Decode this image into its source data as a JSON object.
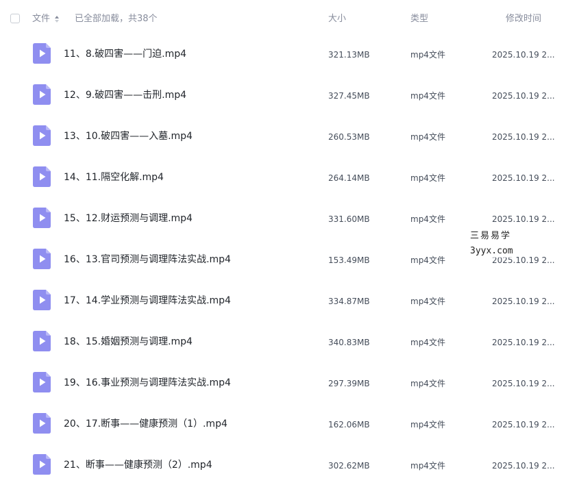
{
  "header": {
    "name_label": "文件",
    "loaded_label": "已全部加载，共38个",
    "size_label": "大小",
    "type_label": "类型",
    "time_label": "修改时间"
  },
  "files": [
    {
      "name": "11、8.破四害——门迫.mp4",
      "size": "321.13MB",
      "type": "mp4文件",
      "time": "2025.10.19 2..."
    },
    {
      "name": "12、9.破四害——击刑.mp4",
      "size": "327.45MB",
      "type": "mp4文件",
      "time": "2025.10.19 2..."
    },
    {
      "name": "13、10.破四害——入墓.mp4",
      "size": "260.53MB",
      "type": "mp4文件",
      "time": "2025.10.19 2..."
    },
    {
      "name": "14、11.隔空化解.mp4",
      "size": "264.14MB",
      "type": "mp4文件",
      "time": "2025.10.19 2..."
    },
    {
      "name": "15、12.财运预测与调理.mp4",
      "size": "331.60MB",
      "type": "mp4文件",
      "time": "2025.10.19 2..."
    },
    {
      "name": "16、13.官司预测与调理阵法实战.mp4",
      "size": "153.49MB",
      "type": "mp4文件",
      "time": "2025.10.19 2..."
    },
    {
      "name": "17、14.学业预测与调理阵法实战.mp4",
      "size": "334.87MB",
      "type": "mp4文件",
      "time": "2025.10.19 2..."
    },
    {
      "name": "18、15.婚姻预测与调理.mp4",
      "size": "340.83MB",
      "type": "mp4文件",
      "time": "2025.10.19 2..."
    },
    {
      "name": "19、16.事业预测与调理阵法实战.mp4",
      "size": "297.39MB",
      "type": "mp4文件",
      "time": "2025.10.19 2..."
    },
    {
      "name": "20、17.断事——健康预测（1）.mp4",
      "size": "162.06MB",
      "type": "mp4文件",
      "time": "2025.10.19 2..."
    },
    {
      "name": "21、断事——健康预测（2）.mp4",
      "size": "302.62MB",
      "type": "mp4文件",
      "time": "2025.10.19 2..."
    }
  ],
  "watermark": {
    "line1": "三易易学",
    "line2": "3yyx.com"
  },
  "colors": {
    "video_icon": "#8f8ef0",
    "video_icon_fold": "#b9b8f7",
    "header_text": "#878c9c"
  }
}
